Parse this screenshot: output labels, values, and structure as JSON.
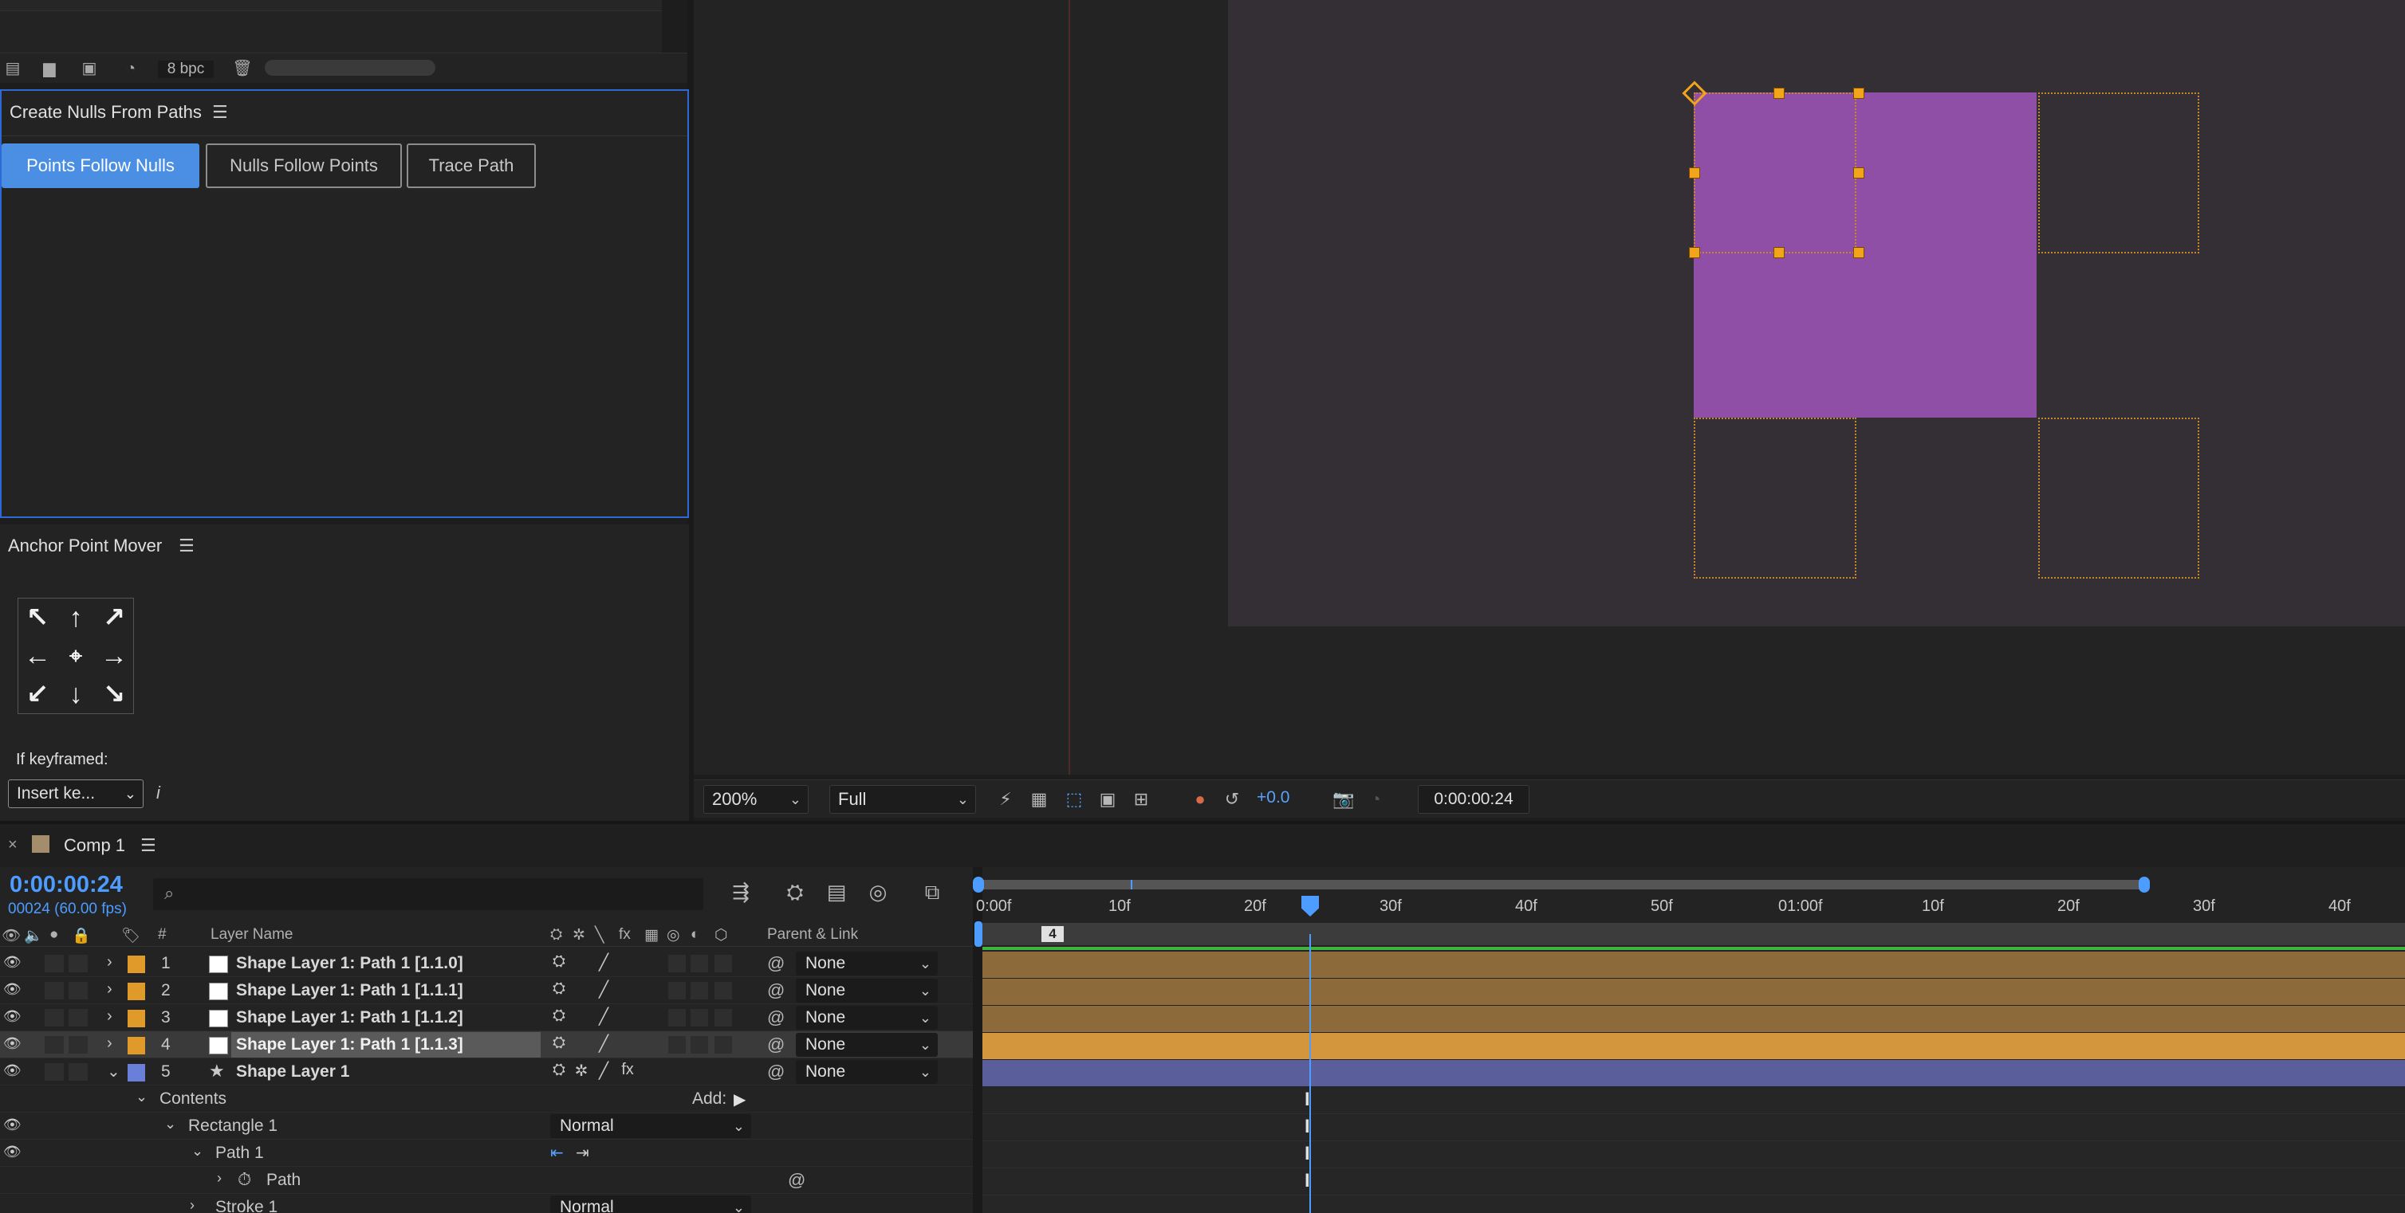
{
  "project": {
    "bpc": "8 bpc"
  },
  "nulls_panel": {
    "title": "Create Nulls From Paths",
    "buttons": [
      "Points Follow Nulls",
      "Nulls Follow Points",
      "Trace Path"
    ]
  },
  "anchor_panel": {
    "title": "Anchor Point Mover",
    "if_keyframed": "If keyframed:",
    "insert_select": "Insert ke...",
    "info": "i"
  },
  "viewer": {
    "zoom": "200%",
    "resolution": "Full",
    "exposure": "+0.0",
    "timecode": "0:00:00:24"
  },
  "timeline": {
    "tab": "Comp 1",
    "timecode": "0:00:00:24",
    "frame_info": "00024 (60.00 fps)",
    "columns": {
      "num": "#",
      "layer_name": "Layer Name",
      "parent": "Parent & Link"
    },
    "layers": [
      {
        "num": "1",
        "name": "Shape Layer 1: Path 1 [1.1.0]",
        "parent": "None"
      },
      {
        "num": "2",
        "name": "Shape Layer 1: Path 1 [1.1.1]",
        "parent": "None"
      },
      {
        "num": "3",
        "name": "Shape Layer 1: Path 1 [1.1.2]",
        "parent": "None"
      },
      {
        "num": "4",
        "name": "Shape Layer 1: Path 1 [1.1.3]",
        "parent": "None"
      },
      {
        "num": "5",
        "name": "Shape Layer 1",
        "parent": "None"
      }
    ],
    "props": {
      "contents": "Contents",
      "add": "Add:",
      "rectangle": "Rectangle 1",
      "rectangle_mode": "Normal",
      "path1": "Path 1",
      "path": "Path",
      "stroke": "Stroke 1",
      "stroke_mode": "Normal"
    },
    "ruler": [
      "0:00f",
      "10f",
      "20f",
      "30f",
      "40f",
      "50f",
      "01:00f",
      "10f",
      "20f",
      "30f",
      "40f"
    ],
    "marker": "4"
  },
  "colors": {
    "accent": "#4a8fe4",
    "comp_purple": "#8f4fa6",
    "label_orange": "#e09a2a",
    "label_blue": "#6a7fd8",
    "track_brown": "#8c6a3a",
    "track_selected": "#d4963c",
    "track_blue": "#5a5f9c"
  }
}
